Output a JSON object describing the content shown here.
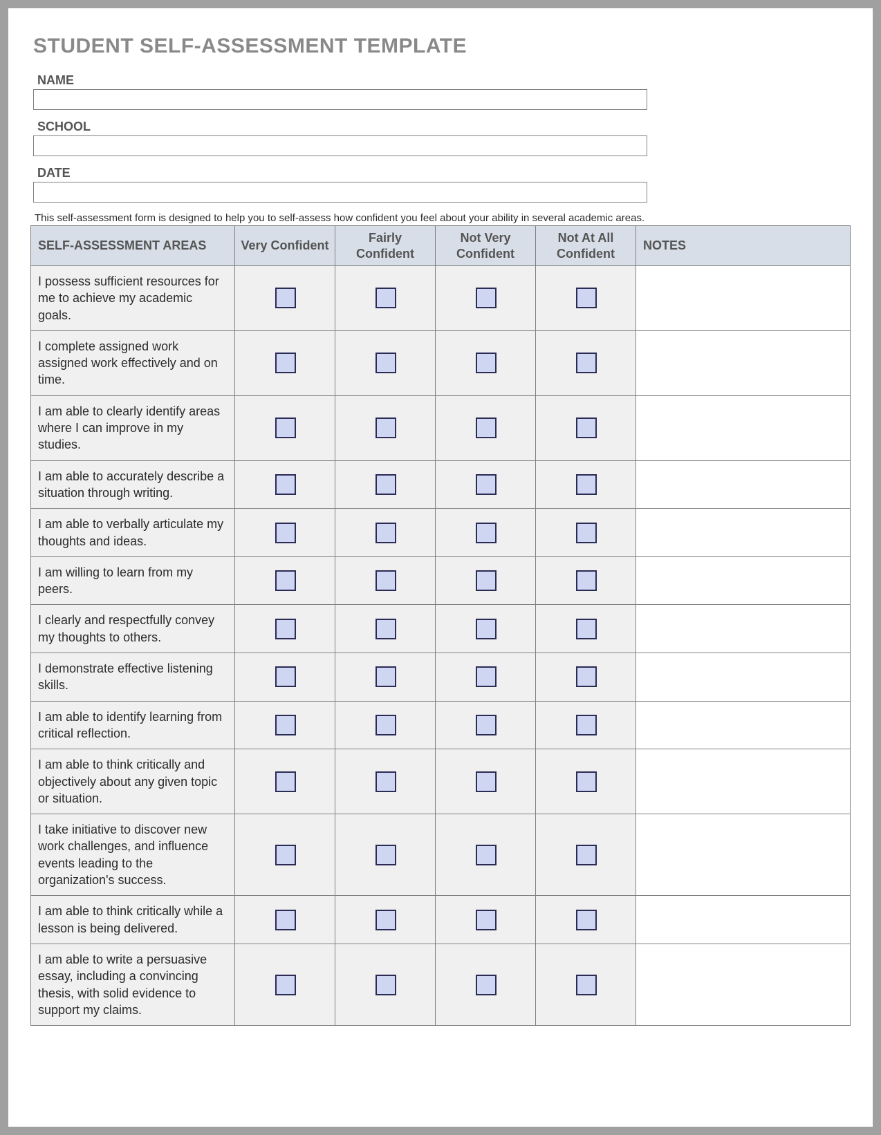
{
  "title": "STUDENT SELF-ASSESSMENT TEMPLATE",
  "fields": {
    "name_label": "NAME",
    "name_value": "",
    "school_label": "SCHOOL",
    "school_value": "",
    "date_label": "DATE",
    "date_value": ""
  },
  "description": "This self-assessment form is designed to help you to self-assess how confident you feel about your ability in several academic areas.",
  "headers": {
    "area": "SELF-ASSESSMENT AREAS",
    "r1": "Very Confident",
    "r2": "Fairly Confident",
    "r3": "Not Very Confident",
    "r4": "Not At All Confident",
    "notes": "NOTES"
  },
  "rows": [
    {
      "area": "I possess sufficient resources for me to achieve my academic goals."
    },
    {
      "area": "I complete assigned work assigned work effectively and on time."
    },
    {
      "area": "I am able to clearly identify areas where I can improve in my studies."
    },
    {
      "area": "I am able to accurately describe a situation through writing."
    },
    {
      "area": "I am able to verbally articulate my thoughts and ideas."
    },
    {
      "area": "I am willing to learn from my peers."
    },
    {
      "area": "I clearly and respectfully convey my thoughts to others."
    },
    {
      "area": "I demonstrate effective listening skills."
    },
    {
      "area": "I am able to identify learning from critical reflection."
    },
    {
      "area": "I am able to think critically and objectively about any given topic or situation."
    },
    {
      "area": "I take initiative to discover new work challenges, and influence events leading to the organization's success."
    },
    {
      "area": "I am able to think critically while a lesson is being delivered."
    },
    {
      "area": "I am able to write a persuasive essay, including a convincing thesis, with solid evidence to support my claims."
    }
  ]
}
